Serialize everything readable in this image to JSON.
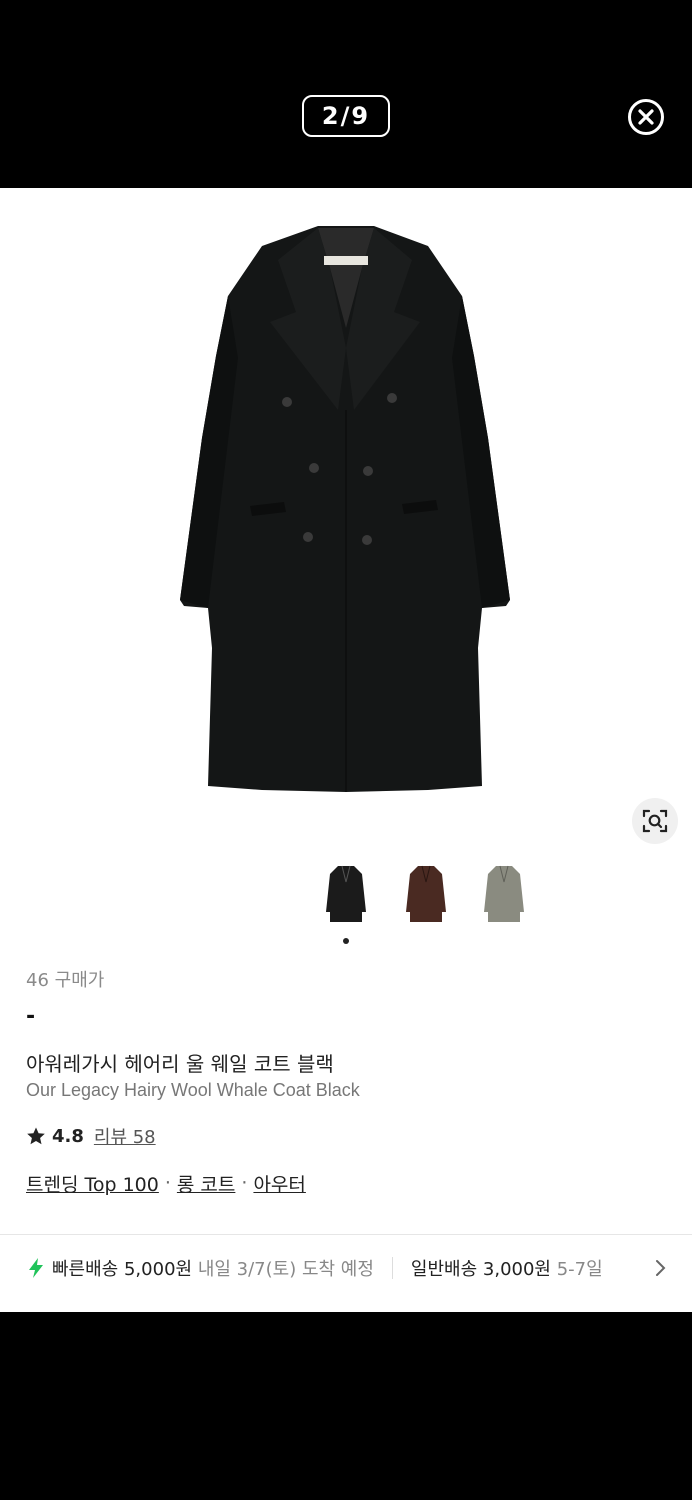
{
  "viewer": {
    "counter": "2/9",
    "close_label": "close"
  },
  "product": {
    "buyers_count": "46",
    "buyers_label": "구매가",
    "price": "-",
    "name_ko": "아워레가시 헤어리 울 웨일 코트 블랙",
    "name_en": "Our Legacy Hairy Wool Whale Coat Black",
    "rating": "4.8",
    "review_label": "리뷰 58",
    "tags": [
      "트렌딩 Top 100",
      "롱 코트",
      "아우터"
    ],
    "tag_separator": "·"
  },
  "colors": {
    "thumb_black": "#1b1b1b",
    "thumb_brown": "#4a2a22",
    "thumb_grey": "#8a8b80",
    "fast_delivery": "#20c35a"
  },
  "delivery": {
    "fast_label": "빠른배송",
    "fast_price": "5,000원",
    "fast_eta": "내일 3/7(토) 도착 예정",
    "normal_label": "일반배송",
    "normal_price": "3,000원",
    "normal_eta": "5-7일"
  }
}
